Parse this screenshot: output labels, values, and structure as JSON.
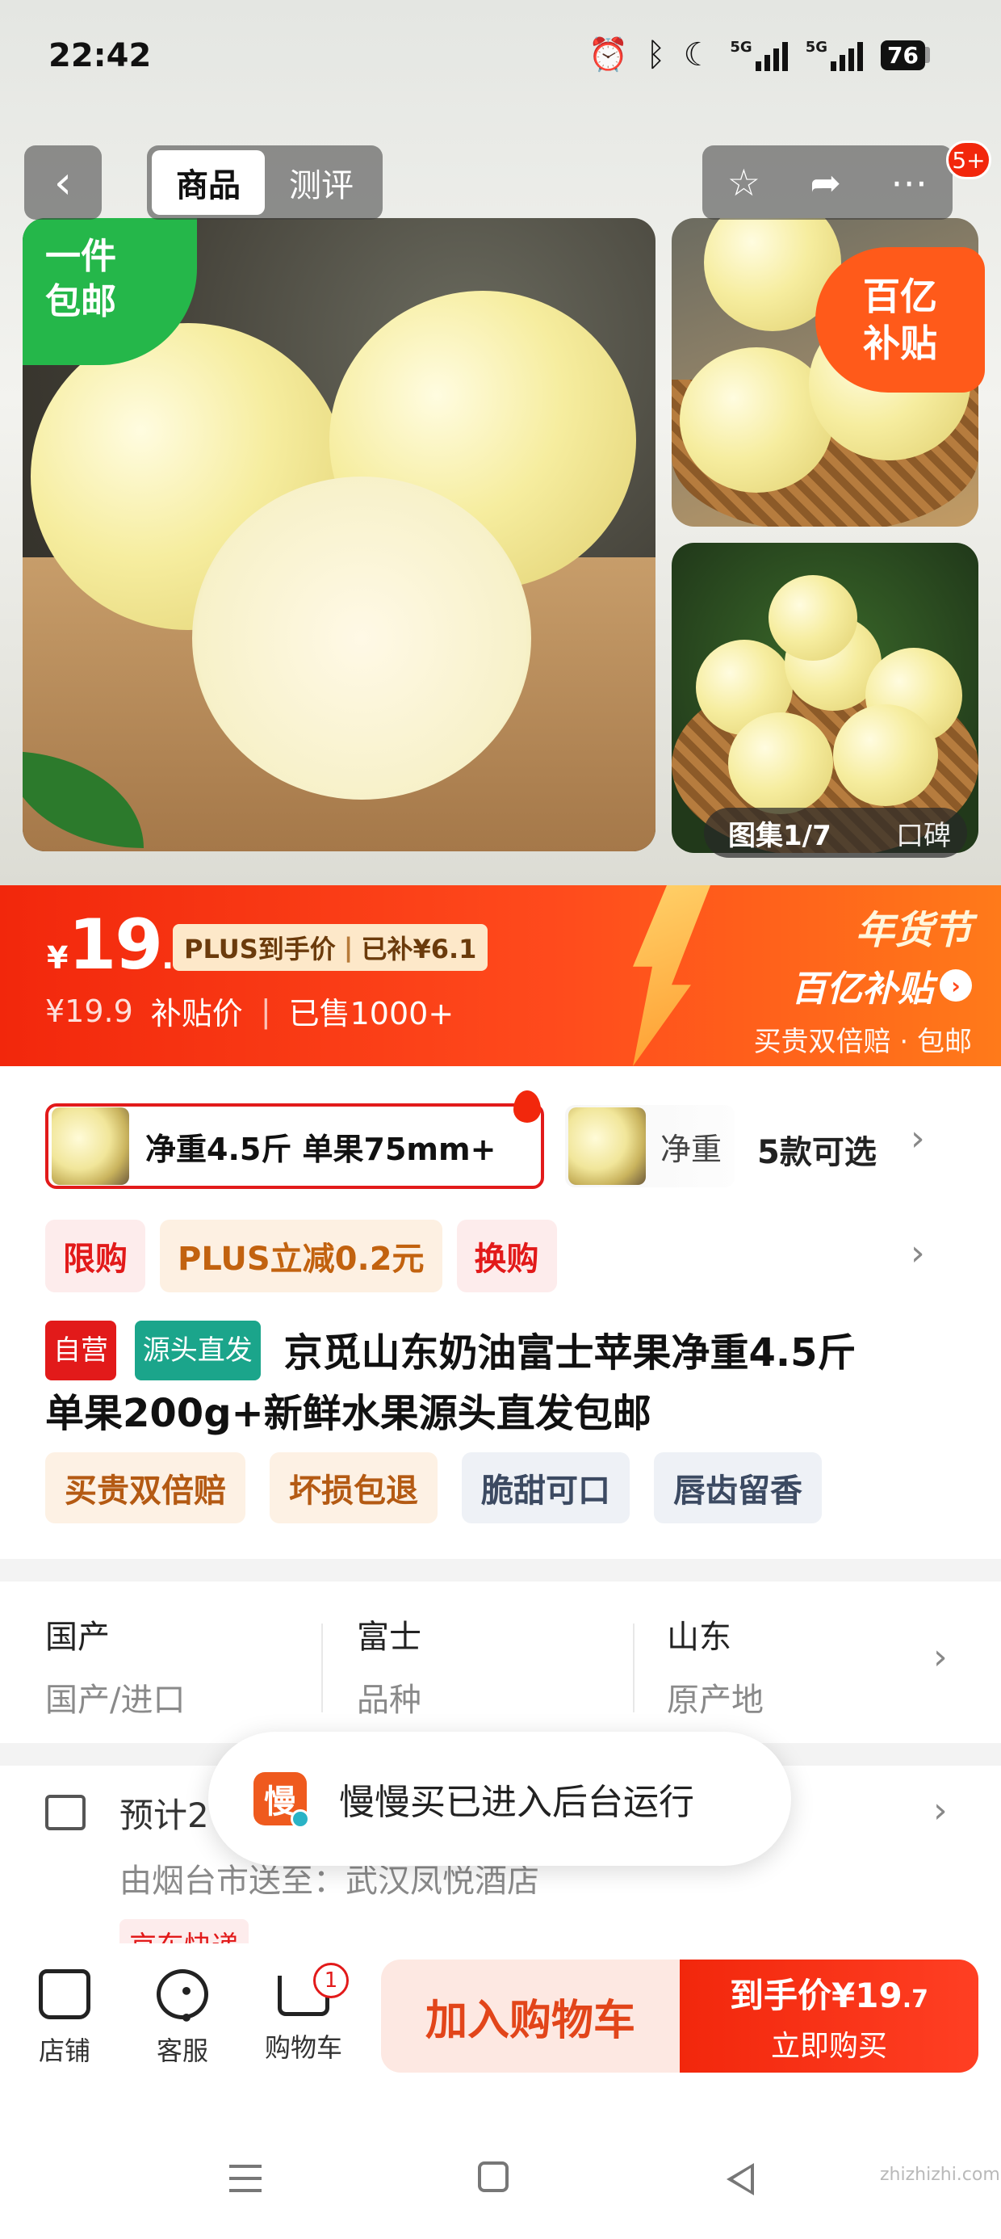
{
  "status_bar": {
    "time": "22:42",
    "icons": [
      "alarm-icon",
      "bluetooth-icon",
      "moon-icon",
      "signal-5g-icon",
      "signal-5g-icon",
      "battery-icon"
    ],
    "signal1_label": "5G",
    "signal2_label": "5G",
    "battery": "76"
  },
  "nav": {
    "back_icon": "chevron-left-icon",
    "tabs": [
      {
        "label": "商品",
        "active": true
      },
      {
        "label": "测评",
        "active": false
      }
    ],
    "actions": [
      "star-icon",
      "share-icon",
      "more-icon"
    ],
    "badge": "5+"
  },
  "gallery": {
    "badge_free_line1": "一件",
    "badge_free_line2": "包邮",
    "badge_subsidy_line1": "百亿",
    "badge_subsidy_line2": "补贴",
    "counter": "图集1/7",
    "reviews": "口碑"
  },
  "price": {
    "currency": "¥",
    "integer": "19",
    "decimal": ".7",
    "plus_label": "PLUS到手价",
    "subsidy_amount": "已补¥6.1",
    "original": "¥19.9",
    "subsidy_price_label": "补贴价",
    "sold": "已售1000+",
    "festival_title": "年货节",
    "festival_sub": "百亿补贴",
    "festival_perks": "买贵双倍赔 · 包邮"
  },
  "variants": {
    "selected": "净重4.5斤 单果75mm+",
    "other": "净重",
    "count": "5款可选"
  },
  "promos": [
    "限购",
    "PLUS立减0.2元",
    "换购"
  ],
  "title": {
    "tag_self": "自营",
    "tag_origin": "源头直发",
    "line1": "京觅山东奶油富士苹果净重4.5斤",
    "line2": "单果200g+新鲜水果源头直发包邮"
  },
  "features": [
    "买贵双倍赔",
    "坏损包退",
    "脆甜可口",
    "唇齿留香"
  ],
  "attributes": [
    {
      "value": "国产",
      "key": "国产/进口"
    },
    {
      "value": "富士",
      "key": "品种"
    },
    {
      "value": "山东",
      "key": "原产地"
    }
  ],
  "delivery": {
    "main": "预计2",
    "sub": "由烟台市送至：武汉凤悦酒店",
    "carrier": "京东快递"
  },
  "toast": {
    "icon_char": "慢",
    "text": "慢慢买已进入后台运行"
  },
  "bottom_bar": {
    "store": "店铺",
    "service": "客服",
    "cart": "购物车",
    "cart_count": "1",
    "add_to_cart": "加入购物车",
    "buy_price_prefix": "到手价¥",
    "buy_price_int": "19",
    "buy_price_dec": ".7",
    "buy_now": "立即购买"
  },
  "watermark": "zhizhizhi.com",
  "colors": {
    "brand_red": "#f2270c",
    "promo_orange": "#ff7a1a",
    "free_shipping_green": "#25b74a"
  }
}
